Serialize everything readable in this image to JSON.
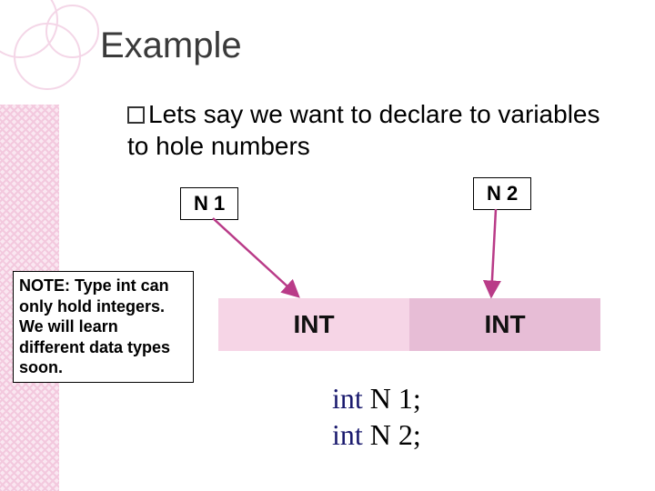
{
  "title": "Example",
  "body": {
    "line": "Lets say we want to declare to variables to hole numbers"
  },
  "labels": {
    "n1": "N 1",
    "n2": "N 2"
  },
  "note": "NOTE: Type int can only hold integers. We will learn different data types soon.",
  "int_row": {
    "a": "INT",
    "b": "INT"
  },
  "code": {
    "kw": "int",
    "line1": " N 1;",
    "line2": " N 2;"
  },
  "colors": {
    "accent": "#b93b88",
    "int_a_bg": "#f6d5e6",
    "int_b_bg": "#e7bdd6"
  }
}
